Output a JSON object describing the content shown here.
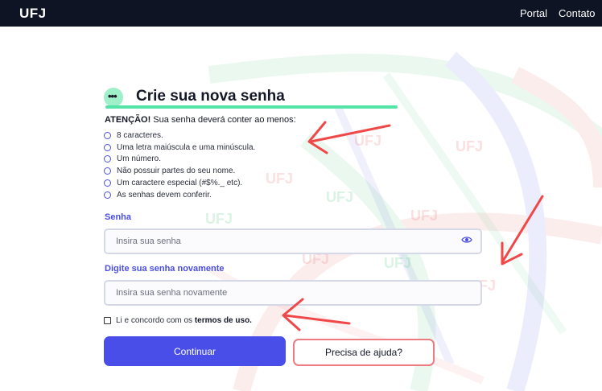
{
  "header": {
    "logo": "UFJ",
    "nav": [
      {
        "label": "Portal"
      },
      {
        "label": "Contato"
      }
    ]
  },
  "background": {
    "watermark_text": "UFJ"
  },
  "form": {
    "title": "Crie sua nova senha",
    "title_icon_glyph": "•••",
    "attention_label": "ATENÇÃO!",
    "attention_text": " Sua senha deverá conter ao menos:",
    "requirements": [
      "8 caracteres.",
      "Uma letra maiúscula e uma minúscula.",
      "Um número.",
      "Não possuir partes do seu nome.",
      "Um caractere especial (#$%._ etc).",
      "As senhas devem conferir."
    ],
    "password_label": "Senha",
    "password_placeholder": "Insira sua senha",
    "password_value": "",
    "confirm_label": "Digite sua senha novamente",
    "confirm_placeholder": "Insira sua senha novamente",
    "confirm_value": "",
    "terms_prefix": "Li e concordo com os ",
    "terms_link": "termos de uso.",
    "continue_label": "Continuar",
    "help_label": "Precisa de ajuda?"
  },
  "icons": {
    "password_toggle": "eye-icon",
    "title_icon": "password-dots-icon"
  },
  "colors": {
    "topbar": "#0e1424",
    "primary": "#4a4ee8",
    "accent_green": "#56e3a8",
    "help_border": "#ee7a82",
    "annotation_arrow": "#f04848"
  }
}
